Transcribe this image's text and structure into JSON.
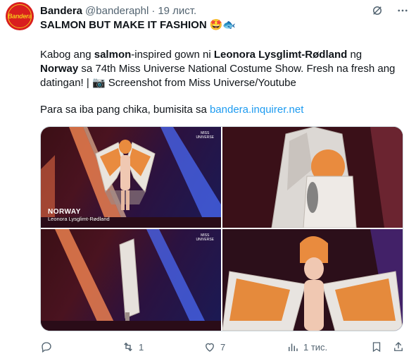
{
  "post": {
    "author_name": "Bandera",
    "author_handle": "@banderaphl",
    "separator": "·",
    "time": "19 лист.",
    "avatar_text": "Bandera",
    "title_text": "SALMON BUT MAKE IT FASHION",
    "title_emoji": "🤩🐟",
    "p1_a": "Kabog ang ",
    "p1_b": "salmon",
    "p1_c": "-inspired gown ni ",
    "p1_d": "Leonora Lysglimt-Rødland",
    "p1_e": " ng",
    "p1_f": "Norway",
    "p1_g": " sa 74th Miss Universe National Costume Show. Fresh na fresh ang datingan! | 📷 Screenshot from Miss Universe/Youtube",
    "p2_a": "Para sa iba pang chika, bumisita sa ",
    "p2_link": "bandera.inquirer.net"
  },
  "media": {
    "caption_country": "NORWAY",
    "caption_name": "Leonora Lysglimt-Rødland",
    "mu_logo_a": "MISS",
    "mu_logo_b": "UNIVERSE"
  },
  "actions": {
    "reply_count": "",
    "repost_count": "1",
    "like_count": "7",
    "views_count": "1 тис."
  },
  "colors": {
    "link": "#1d9bf0",
    "muted": "#536471",
    "avatar_bg": "#d91e1e",
    "avatar_accent": "#f4c21b"
  },
  "icons": [
    "grok-icon",
    "more-icon",
    "reply-icon",
    "repost-icon",
    "like-icon",
    "views-icon",
    "bookmark-icon",
    "share-icon"
  ]
}
